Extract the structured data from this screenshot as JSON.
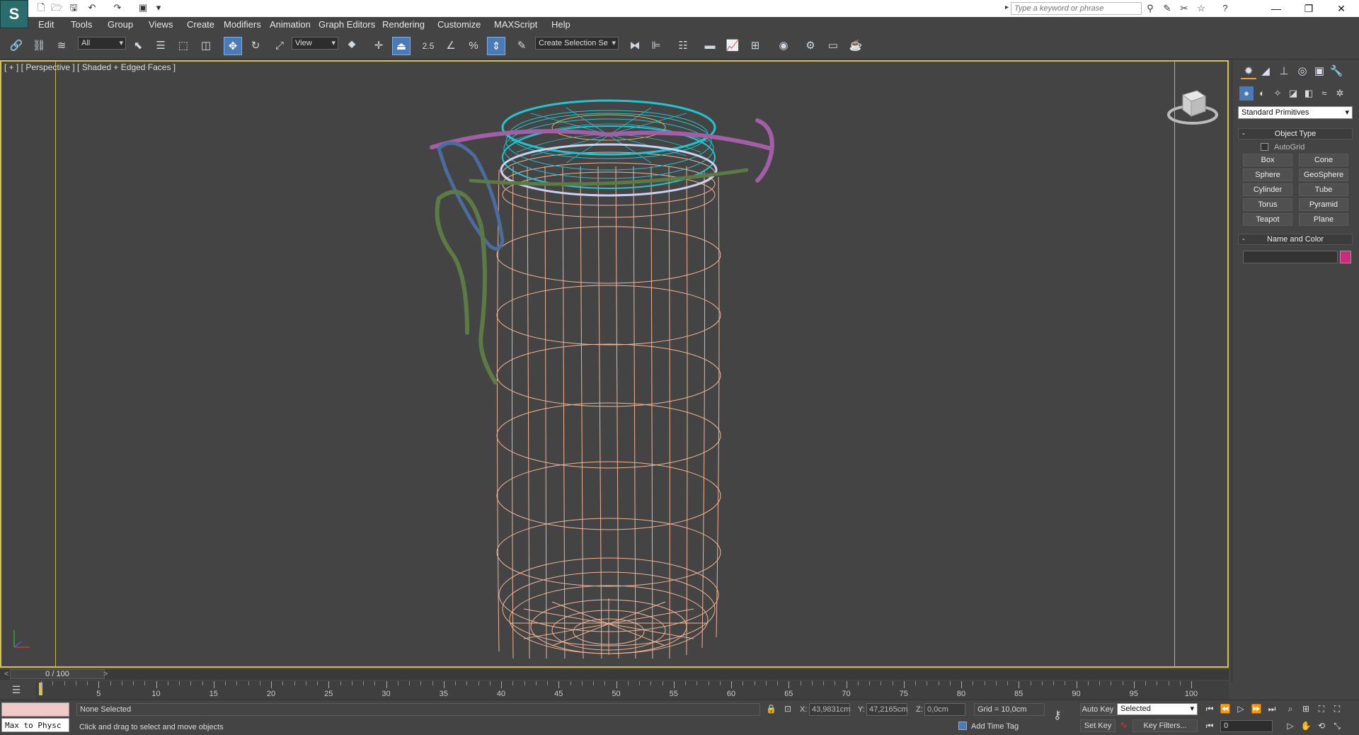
{
  "menu": [
    "Edit",
    "Tools",
    "Group",
    "Views",
    "Create",
    "Modifiers",
    "Animation",
    "Graph Editors",
    "Rendering",
    "Customize",
    "MAXScript",
    "Help"
  ],
  "search": {
    "placeholder": "Type a keyword or phrase"
  },
  "toolbar": {
    "selection_filter": "All",
    "ref_coord": "View",
    "named_selection": "Create Selection Se",
    "snap_label": "2.5"
  },
  "viewport": {
    "label": "[ + ] [ Perspective ] [ Shaded + Edged Faces ]"
  },
  "panel": {
    "category": "Standard Primitives",
    "object_type_title": "Object Type",
    "autogrid_label": "AutoGrid",
    "primitives": [
      "Box",
      "Cone",
      "Sphere",
      "GeoSphere",
      "Cylinder",
      "Tube",
      "Torus",
      "Pyramid",
      "Teapot",
      "Plane"
    ],
    "name_color_title": "Name and Color",
    "object_color": "#cc2a7a",
    "collapse_sign": "-"
  },
  "timeline": {
    "position": "0 / 100",
    "left_arrow": "<",
    "right_arrow": ">",
    "ticks": [
      "5",
      "10",
      "15",
      "20",
      "25",
      "30",
      "35",
      "40",
      "45",
      "50",
      "55",
      "60",
      "65",
      "70",
      "75",
      "80",
      "85",
      "90",
      "95",
      "100"
    ]
  },
  "status": {
    "selection": "None Selected",
    "prompt": "Click and drag to select and move objects",
    "script_listener": "Max to Physc",
    "x_label": "X:",
    "x_value": "43,9831cm",
    "y_label": "Y:",
    "y_value": "47,2165cm",
    "z_label": "Z:",
    "z_value": "0,0cm",
    "grid": "Grid = 10,0cm",
    "add_time_tag": "Add Time Tag",
    "auto_key": "Auto Key",
    "auto_key_mode": "Selected",
    "set_key": "Set Key",
    "key_filters": "Key Filters...",
    "frame": "0"
  }
}
